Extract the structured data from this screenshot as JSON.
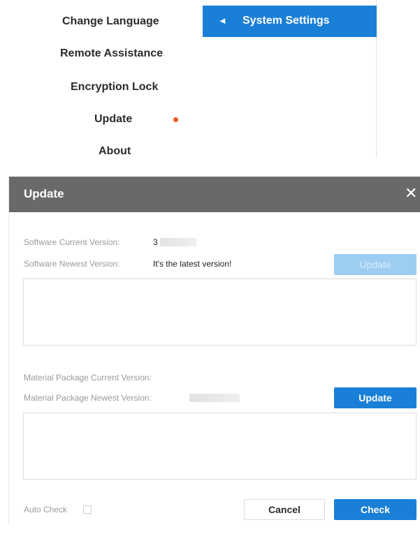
{
  "menu": {
    "items": [
      {
        "label": "Change Language"
      },
      {
        "label": "Remote Assistance"
      },
      {
        "label": "Encryption Lock"
      },
      {
        "label": "Update",
        "notification": true
      },
      {
        "label": "About"
      }
    ]
  },
  "system_settings": {
    "back_glyph": "◄",
    "title": "System Settings"
  },
  "dialog": {
    "title": "Update",
    "close_glyph": "✕",
    "software": {
      "current_label": "Software Current Version:",
      "current_value": "3",
      "newest_label": "Software Newest Version:",
      "newest_value": "It's the latest version!",
      "update_button": "Update",
      "update_enabled": false
    },
    "material": {
      "current_label": "Material Package Current Version:",
      "current_value": "",
      "newest_label": "Material Package Newest Version:",
      "update_button": "Update",
      "update_enabled": true
    },
    "auto_check_label": "Auto Check",
    "auto_check_checked": false,
    "cancel_button": "Cancel",
    "check_button": "Check"
  },
  "colors": {
    "accent": "#1a7fd6",
    "notification_dot": "#ee5a24",
    "dialog_header": "#696969"
  }
}
